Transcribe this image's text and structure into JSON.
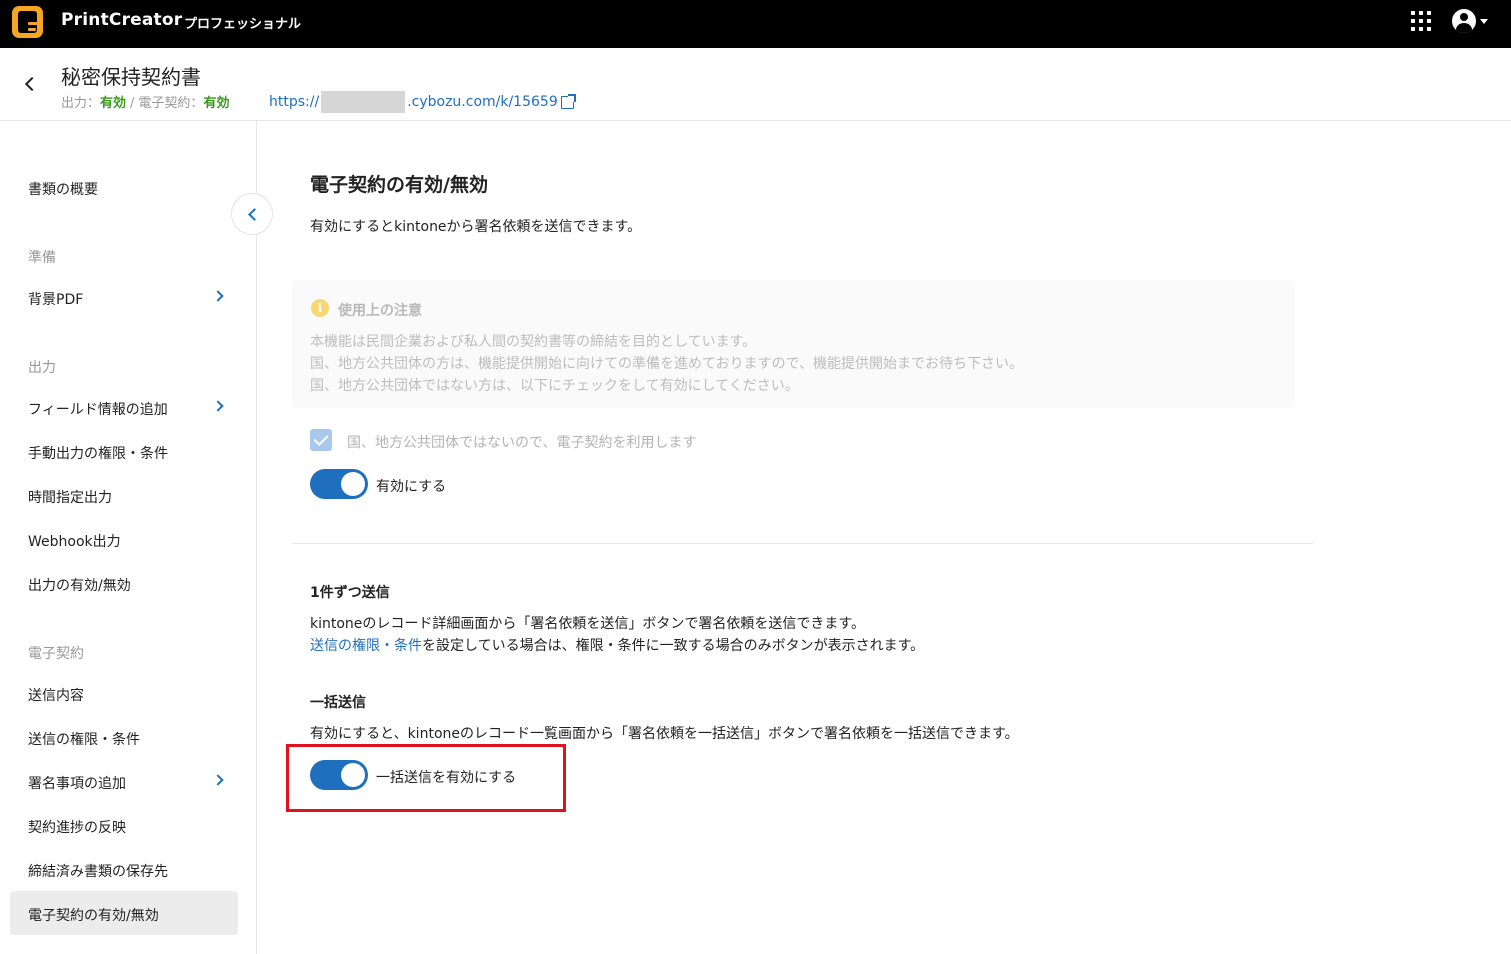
{
  "topbar": {
    "brand": "PrintCreator",
    "edition": "プロフェッショナル",
    "icons": [
      "apps-grid-icon",
      "account-icon"
    ]
  },
  "header": {
    "title": "秘密保持契約書",
    "output_label": "出力：",
    "output_status": "有効",
    "separator": "/",
    "econtract_label": "電子契約：",
    "econtract_status": "有効",
    "url_prefix": "https://",
    "url_suffix": ".cybozu.com/k/15659"
  },
  "sidebar": {
    "overview": "書類の概要",
    "sections": {
      "prep": "準備",
      "output": "出力",
      "econtract": "電子契約"
    },
    "items": {
      "background_pdf": "背景PDF",
      "add_field_info": "フィールド情報の追加",
      "manual_output_perm": "手動出力の権限・条件",
      "scheduled_output": "時間指定出力",
      "webhook_output": "Webhook出力",
      "output_toggle": "出力の有効/無効",
      "send_content": "送信内容",
      "send_perm": "送信の権限・条件",
      "add_signature": "署名事項の追加",
      "reflect_progress": "契約進捗の反映",
      "storage": "締結済み書類の保存先",
      "econtract_toggle": "電子契約の有効/無効"
    }
  },
  "main": {
    "title": "電子契約の有効/無効",
    "description": "有効にするとkintoneから署名依頼を送信できます。",
    "notice": {
      "title": "使用上の注意",
      "lines": [
        "本機能は民間企業および私人間の契約書等の締結を目的としています。",
        "国、地方公共団体の方は、機能提供開始に向けての準備を進めておりますので、機能提供開始までお待ち下さい。",
        "国、地方公共団体ではない方は、以下にチェックをして有効にしてください。"
      ]
    },
    "checkbox_label": "国、地方公共団体ではないので、電子契約を利用します",
    "enable_label": "有効にする",
    "single": {
      "title": "1件ずつ送信",
      "line1": "kintoneのレコード詳細画面から「署名依頼を送信」ボタンで署名依頼を送信できます。",
      "link": "送信の権限・条件",
      "line2_rest": "を設定している場合は、権限・条件に一致する場合のみボタンが表示されます。"
    },
    "bulk": {
      "title": "一括送信",
      "line1": "有効にすると、kintoneのレコード一覧画面から「署名依頼を一括送信」ボタンで署名依頼を一括送信できます。",
      "toggle_label": "一括送信を有効にする"
    }
  },
  "colors": {
    "accent": "#1f6fbf",
    "status_ok": "#3a9a1e",
    "highlight": "#e0121d"
  }
}
